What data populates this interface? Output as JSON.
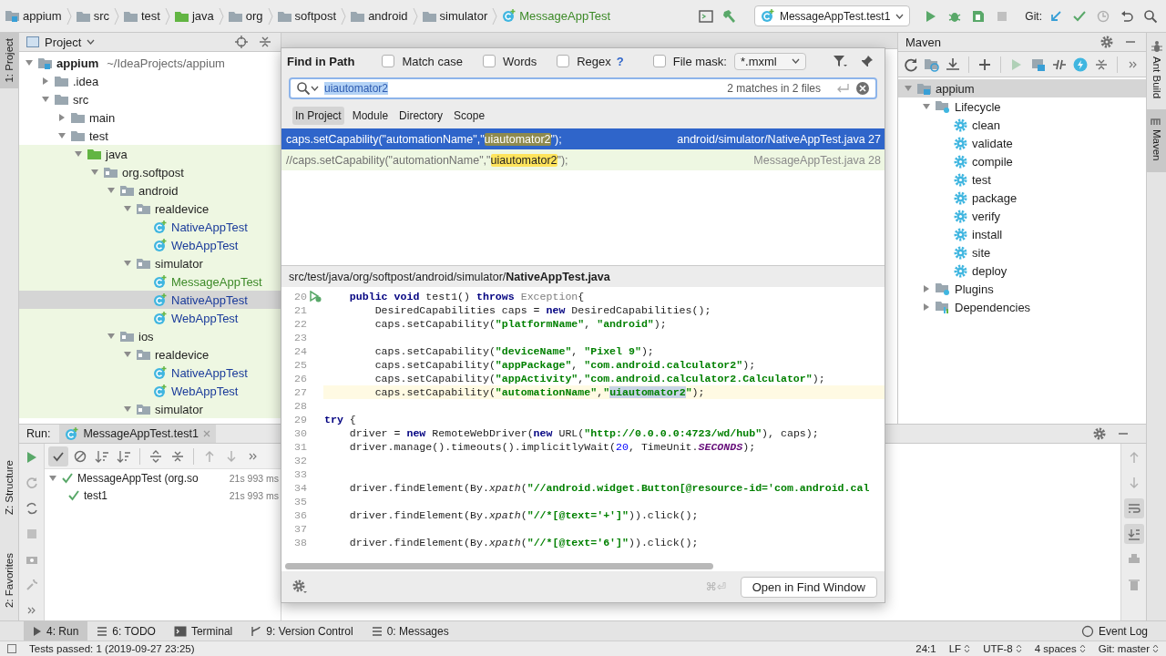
{
  "breadcrumbs": [
    {
      "label": "appium",
      "kind": "module",
      "added": false
    },
    {
      "label": "src",
      "kind": "folder",
      "added": false
    },
    {
      "label": "test",
      "kind": "folder",
      "added": false
    },
    {
      "label": "java",
      "kind": "test_folder",
      "added": false
    },
    {
      "label": "org",
      "kind": "folder",
      "added": false
    },
    {
      "label": "softpost",
      "kind": "folder",
      "added": false
    },
    {
      "label": "android",
      "kind": "folder",
      "added": false
    },
    {
      "label": "simulator",
      "kind": "folder",
      "added": false
    },
    {
      "label": "MessageAppTest",
      "kind": "class",
      "added": true
    }
  ],
  "run_config": "MessageAppTest.test1",
  "git_label": "Git:",
  "left_stripe": [
    {
      "label": "1: Project",
      "selected": true
    },
    {
      "label": "Z: Structure",
      "selected": false
    },
    {
      "label": "2: Favorites",
      "selected": false
    }
  ],
  "project_panel": {
    "title": "Project",
    "tree": [
      {
        "label": "appium",
        "note": "~/IdeaProjects/appium",
        "kind": "module",
        "expanded": true,
        "selected": false,
        "children": [
          {
            "label": ".idea",
            "kind": "folder",
            "expanded": false,
            "selected": false
          },
          {
            "label": "src",
            "kind": "folder",
            "expanded": true,
            "selected": false,
            "children": [
              {
                "label": "main",
                "kind": "folder",
                "expanded": false,
                "selected": false
              },
              {
                "label": "test",
                "kind": "folder",
                "expanded": true,
                "selected": false,
                "children": [
                  {
                    "label": "java",
                    "kind": "test_folder",
                    "expanded": true,
                    "selected": false,
                    "children": [
                      {
                        "label": "org.softpost",
                        "kind": "package",
                        "expanded": true,
                        "selected": false,
                        "children": [
                          {
                            "label": "android",
                            "kind": "package",
                            "expanded": true,
                            "selected": false,
                            "children": [
                              {
                                "label": "realdevice",
                                "kind": "package",
                                "expanded": true,
                                "selected": false,
                                "children": [
                                  {
                                    "label": "NativeAppTest",
                                    "kind": "class",
                                    "added": false,
                                    "selected": false
                                  },
                                  {
                                    "label": "WebAppTest",
                                    "kind": "class",
                                    "added": false,
                                    "selected": false
                                  }
                                ]
                              },
                              {
                                "label": "simulator",
                                "kind": "package",
                                "expanded": true,
                                "selected": false,
                                "children": [
                                  {
                                    "label": "MessageAppTest",
                                    "kind": "class",
                                    "added": true,
                                    "selected": false
                                  },
                                  {
                                    "label": "NativeAppTest",
                                    "kind": "class",
                                    "added": false,
                                    "selected": true
                                  },
                                  {
                                    "label": "WebAppTest",
                                    "kind": "class",
                                    "added": false,
                                    "selected": false
                                  }
                                ]
                              }
                            ]
                          },
                          {
                            "label": "ios",
                            "kind": "package",
                            "expanded": true,
                            "selected": false,
                            "children": [
                              {
                                "label": "realdevice",
                                "kind": "package",
                                "expanded": true,
                                "selected": false,
                                "children": [
                                  {
                                    "label": "NativeAppTest",
                                    "kind": "class",
                                    "added": false,
                                    "selected": false
                                  },
                                  {
                                    "label": "WebAppTest",
                                    "kind": "class",
                                    "added": false,
                                    "selected": false
                                  }
                                ]
                              },
                              {
                                "label": "simulator",
                                "kind": "package",
                                "expanded": true,
                                "selected": false
                              }
                            ]
                          }
                        ]
                      }
                    ]
                  }
                ]
              }
            ]
          }
        ]
      }
    ]
  },
  "maven_panel": {
    "title": "Maven",
    "tree": [
      {
        "label": "appium",
        "kind": "maven_module",
        "expanded": true,
        "selected": true,
        "children": [
          {
            "label": "Lifecycle",
            "kind": "lifecycle",
            "expanded": true,
            "selected": false,
            "children": [
              {
                "label": "clean",
                "kind": "goal",
                "selected": false
              },
              {
                "label": "validate",
                "kind": "goal",
                "selected": false
              },
              {
                "label": "compile",
                "kind": "goal",
                "selected": false
              },
              {
                "label": "test",
                "kind": "goal",
                "selected": false
              },
              {
                "label": "package",
                "kind": "goal",
                "selected": false
              },
              {
                "label": "verify",
                "kind": "goal",
                "selected": false
              },
              {
                "label": "install",
                "kind": "goal",
                "selected": false
              },
              {
                "label": "site",
                "kind": "goal",
                "selected": false
              },
              {
                "label": "deploy",
                "kind": "goal",
                "selected": false
              }
            ]
          },
          {
            "label": "Plugins",
            "kind": "lifecycle",
            "expanded": false,
            "selected": false
          },
          {
            "label": "Dependencies",
            "kind": "dependencies",
            "expanded": false,
            "selected": false
          }
        ]
      }
    ]
  },
  "right_stripe": [
    {
      "label": "Ant Build",
      "selected": false
    },
    {
      "label": "Maven",
      "selected": true
    }
  ],
  "run_panel": {
    "label": "Run:",
    "tab": "MessageAppTest.test1",
    "tree": [
      {
        "label": "MessageAppTest (org.so",
        "time": "21s 993 ms",
        "passed": true,
        "children": [
          {
            "label": "test1",
            "time": "21s 993 ms",
            "passed": true
          }
        ]
      }
    ]
  },
  "find_dialog": {
    "title": "Find in Path",
    "options": [
      {
        "label": "Match case",
        "checked": false
      },
      {
        "label": "Words",
        "checked": false
      },
      {
        "label": "Regex",
        "checked": false,
        "help": "?"
      },
      {
        "label": "File mask:",
        "checked": false
      }
    ],
    "file_mask": "*.mxml",
    "query": "uiautomator2",
    "match_count": "2 matches in 2 files",
    "scopes": [
      {
        "label": "In Project",
        "selected": true
      },
      {
        "label": "Module",
        "selected": false
      },
      {
        "label": "Directory",
        "selected": false
      },
      {
        "label": "Scope",
        "selected": false
      }
    ],
    "results": [
      {
        "selected": true,
        "segments": [
          {
            "kind": "plain",
            "text": "caps.setCapability(\"automationName\",\""
          },
          {
            "kind": "match",
            "text": "uiautomator2"
          },
          {
            "kind": "plain",
            "text": "\");"
          }
        ],
        "file": "android/simulator/NativeAppTest.java",
        "line": "27"
      },
      {
        "selected": false,
        "segments": [
          {
            "kind": "comment",
            "text": "//caps.setCapability(\"automationName\",\""
          },
          {
            "kind": "match",
            "text": "uiautomator2"
          },
          {
            "kind": "comment",
            "text": "\");"
          }
        ],
        "file": "MessageAppTest.java",
        "line": "28"
      }
    ],
    "preview_path": "src/test/java/org/softpost/android/simulator/**NativeAppTest.java**",
    "code": [
      {
        "number": "20",
        "run_gutter": true,
        "segments": [
          {
            "kind": "keyword",
            "text": "    public void"
          },
          {
            "kind": "plain",
            "text": " test1() "
          },
          {
            "kind": "keyword",
            "text": "throws"
          },
          {
            "kind": "muted",
            "text": " Exception"
          },
          {
            "kind": "plain",
            "text": "{"
          }
        ]
      },
      {
        "number": "21",
        "segments": [
          {
            "kind": "plain",
            "text": "        DesiredCapabilities caps = "
          },
          {
            "kind": "keyword",
            "text": "new"
          },
          {
            "kind": "plain",
            "text": " DesiredCapabilities();"
          }
        ]
      },
      {
        "number": "22",
        "segments": [
          {
            "kind": "plain",
            "text": "        caps.setCapability("
          },
          {
            "kind": "string",
            "text": "\"platformName\""
          },
          {
            "kind": "plain",
            "text": ", "
          },
          {
            "kind": "string",
            "text": "\"android\""
          },
          {
            "kind": "plain",
            "text": ");"
          }
        ]
      },
      {
        "number": "23"
      },
      {
        "number": "24",
        "segments": [
          {
            "kind": "plain",
            "text": "        caps.setCapability("
          },
          {
            "kind": "string",
            "text": "\"deviceName\""
          },
          {
            "kind": "plain",
            "text": ", "
          },
          {
            "kind": "string",
            "text": "\"Pixel 9\""
          },
          {
            "kind": "plain",
            "text": ");"
          }
        ]
      },
      {
        "number": "25",
        "segments": [
          {
            "kind": "plain",
            "text": "        caps.setCapability("
          },
          {
            "kind": "string",
            "text": "\"appPackage\""
          },
          {
            "kind": "plain",
            "text": ", "
          },
          {
            "kind": "string",
            "text": "\"com.android.calculator2\""
          },
          {
            "kind": "plain",
            "text": ");"
          }
        ]
      },
      {
        "number": "26",
        "segments": [
          {
            "kind": "plain",
            "text": "        caps.setCapability("
          },
          {
            "kind": "string",
            "text": "\"appActivity\""
          },
          {
            "kind": "plain",
            "text": ","
          },
          {
            "kind": "string",
            "text": "\"com.android.calculator2.Calculator\""
          },
          {
            "kind": "plain",
            "text": ");"
          }
        ]
      },
      {
        "number": "27",
        "current": true,
        "segments": [
          {
            "kind": "plain",
            "text": "        caps.setCapability("
          },
          {
            "kind": "string",
            "text": "\"automationName\""
          },
          {
            "kind": "plain",
            "text": ","
          },
          {
            "kind": "string",
            "text": "\""
          },
          {
            "kind": "match",
            "text": "uiautomator2"
          },
          {
            "kind": "string",
            "text": "\""
          },
          {
            "kind": "plain",
            "text": ");"
          }
        ]
      },
      {
        "number": "28"
      },
      {
        "number": "29",
        "segments": [
          {
            "kind": "keyword",
            "text": "try"
          },
          {
            "kind": "plain",
            "text": " {"
          }
        ]
      },
      {
        "number": "30",
        "segments": [
          {
            "kind": "plain",
            "text": "    driver = "
          },
          {
            "kind": "keyword",
            "text": "new"
          },
          {
            "kind": "plain",
            "text": " RemoteWebDriver("
          },
          {
            "kind": "keyword",
            "text": "new"
          },
          {
            "kind": "plain",
            "text": " URL("
          },
          {
            "kind": "string",
            "text": "\"http://0.0.0.0:4723/wd/hub\""
          },
          {
            "kind": "plain",
            "text": "), caps);"
          }
        ]
      },
      {
        "number": "31",
        "segments": [
          {
            "kind": "plain",
            "text": "    driver.manage().timeouts().implicitlyWait("
          },
          {
            "kind": "number",
            "text": "20"
          },
          {
            "kind": "plain",
            "text": ", TimeUnit."
          },
          {
            "kind": "constant",
            "text": "SECONDS"
          },
          {
            "kind": "plain",
            "text": ");"
          }
        ]
      },
      {
        "number": "32"
      },
      {
        "number": "33"
      },
      {
        "number": "34",
        "segments": [
          {
            "kind": "plain",
            "text": "    driver.findElement(By."
          },
          {
            "kind": "italic",
            "text": "xpath"
          },
          {
            "kind": "plain",
            "text": "("
          },
          {
            "kind": "string",
            "text": "\"//android.widget.Button[@resource-id='com.android.cal"
          }
        ]
      },
      {
        "number": "35"
      },
      {
        "number": "36",
        "segments": [
          {
            "kind": "plain",
            "text": "    driver.findElement(By."
          },
          {
            "kind": "italic",
            "text": "xpath"
          },
          {
            "kind": "plain",
            "text": "("
          },
          {
            "kind": "string",
            "text": "\"//*[@text='+']\""
          },
          {
            "kind": "plain",
            "text": ")).click();"
          }
        ]
      },
      {
        "number": "37"
      },
      {
        "number": "38",
        "segments": [
          {
            "kind": "plain",
            "text": "    driver.findElement(By."
          },
          {
            "kind": "italic",
            "text": "xpath"
          },
          {
            "kind": "plain",
            "text": "("
          },
          {
            "kind": "string",
            "text": "\"//*[@text='6']\""
          },
          {
            "kind": "plain",
            "text": ")).click();"
          }
        ]
      }
    ],
    "shortcut": "⌘⏎",
    "open_button": "Open in Find Window"
  },
  "tool_tabs": [
    {
      "label": "4: Run",
      "selected": true
    },
    {
      "label": "6: TODO",
      "selected": false
    },
    {
      "label": "Terminal",
      "selected": false
    },
    {
      "label": "9: Version Control",
      "selected": false
    },
    {
      "label": "0: Messages",
      "selected": false
    }
  ],
  "event_log": "Event Log",
  "status_bar": {
    "message": "Tests passed: 1 (2019-09-27 23:25)",
    "items": [
      {
        "label": "24:1",
        "switch": false
      },
      {
        "label": "LF",
        "switch": true
      },
      {
        "label": "UTF-8",
        "switch": true
      },
      {
        "label": "4 spaces",
        "switch": true
      },
      {
        "label": "Git: master",
        "switch": true
      }
    ]
  }
}
